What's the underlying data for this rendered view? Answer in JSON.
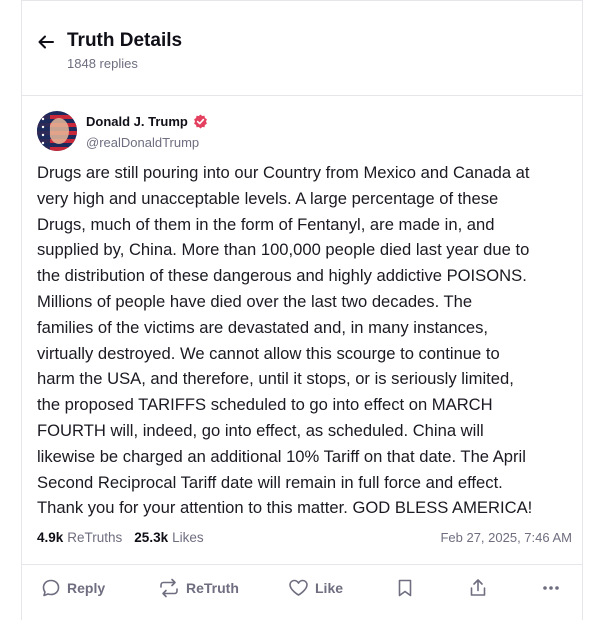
{
  "header": {
    "title": "Truth Details",
    "replies": "1848 replies"
  },
  "author": {
    "name": "Donald J. Trump",
    "handle": "@realDonaldTrump",
    "verified_color": "#e4405f"
  },
  "post": {
    "lines": [
      "Drugs are still pouring into our Country from Mexico and Canada at",
      "very high and unacceptable levels. A large percentage of these",
      "Drugs, much of them in the form of Fentanyl, are made in, and",
      "supplied by, China. More than 100,000 people died last year due to",
      "the distribution of these dangerous and highly addictive POISONS.",
      "Millions of people have died over the last two decades. The",
      "families of the victims are devastated and, in many instances,",
      "virtually destroyed. We cannot allow this scourge to continue to",
      "harm the USA, and therefore, until it stops, or is seriously limited,",
      "the proposed TARIFFS scheduled to go into effect on MARCH",
      "FOURTH will, indeed, go into effect, as scheduled. China will",
      "likewise be charged an additional 10% Tariff on that date. The April",
      "Second Reciprocal Tariff date will remain in full force and effect.",
      "Thank you for your attention to this matter. GOD BLESS AMERICA!"
    ]
  },
  "stats": {
    "retruths_count": "4.9k",
    "retruths_label": "ReTruths",
    "likes_count": "25.3k",
    "likes_label": "Likes",
    "timestamp": "Feb 27, 2025, 7:46 AM"
  },
  "actions": {
    "reply": "Reply",
    "retruth": "ReTruth",
    "like": "Like"
  },
  "icons": {
    "back": "arrow-left-icon",
    "reply": "speech-bubble-icon",
    "retruth": "repost-arrows-icon",
    "like": "heart-icon",
    "bookmark": "bookmark-icon",
    "share": "share-icon",
    "more": "ellipsis-icon"
  }
}
